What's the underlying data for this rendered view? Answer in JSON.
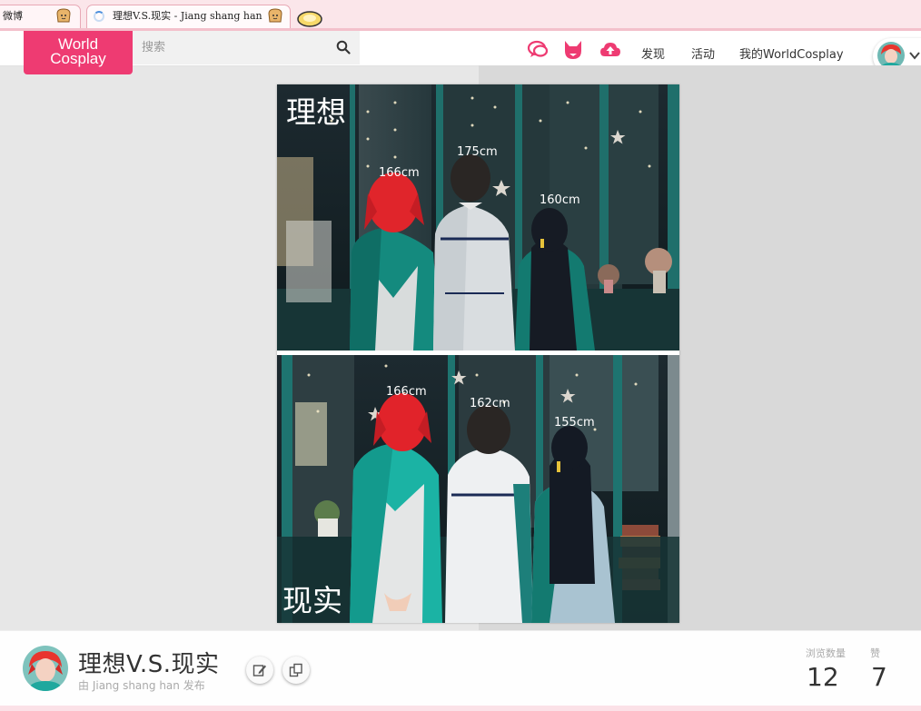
{
  "browser": {
    "tabs": [
      {
        "label": "微博",
        "active": false
      },
      {
        "label": "理想V.S.现实 - Jiang shang han",
        "active": true,
        "loading": true
      }
    ]
  },
  "header": {
    "logo_line1": "World",
    "logo_line2": "Cosplay",
    "search_placeholder": "搜索",
    "nav": {
      "discover": "发现",
      "activity": "活动",
      "my_worldcosplay": "我的WorldCosplay"
    },
    "icons": [
      "chat-icon",
      "fox-icon",
      "upload-icon",
      "search-icon",
      "chevron-down-icon"
    ]
  },
  "photo": {
    "top_caption": "理想",
    "bottom_caption": "现实",
    "top_heights": [
      "166cm",
      "175cm",
      "160cm"
    ],
    "bottom_heights": [
      "166cm",
      "162cm",
      "155cm"
    ]
  },
  "post": {
    "title": "理想V.S.现实",
    "author_line": "由 Jiang shang han 发布",
    "views_label": "浏览数量",
    "views_value": "12",
    "likes_label": "赞",
    "likes_value": "7"
  },
  "colors": {
    "brand_pink": "#ee3b72",
    "tab_strip": "#fbe6ea",
    "teal": "#1f7f78"
  }
}
